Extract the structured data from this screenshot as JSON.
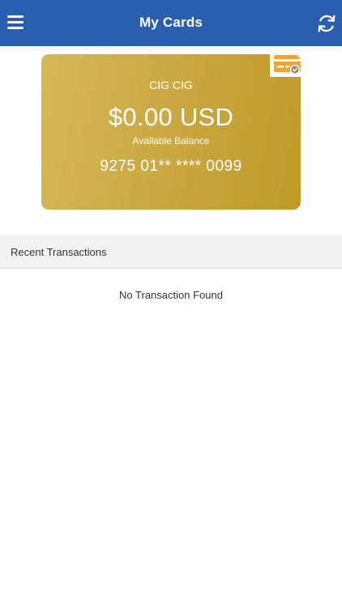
{
  "app_bar": {
    "title": "My Cards",
    "background": "#2a5fb0",
    "menu_icon": "hamburger-menu-icon",
    "refresh_icon": "refresh-icon"
  },
  "card": {
    "holder_name": "CIG CIG",
    "balance": "$0.00 USD",
    "balance_label": "Available Balance",
    "masked_number": "9275 01** **** 0099",
    "badge_icon": "card-check-icon",
    "color": "#c9a63e",
    "badge_color": "#f0a23a"
  },
  "transactions": {
    "header": "Recent Transactions",
    "empty_message": "No Transaction Found"
  }
}
